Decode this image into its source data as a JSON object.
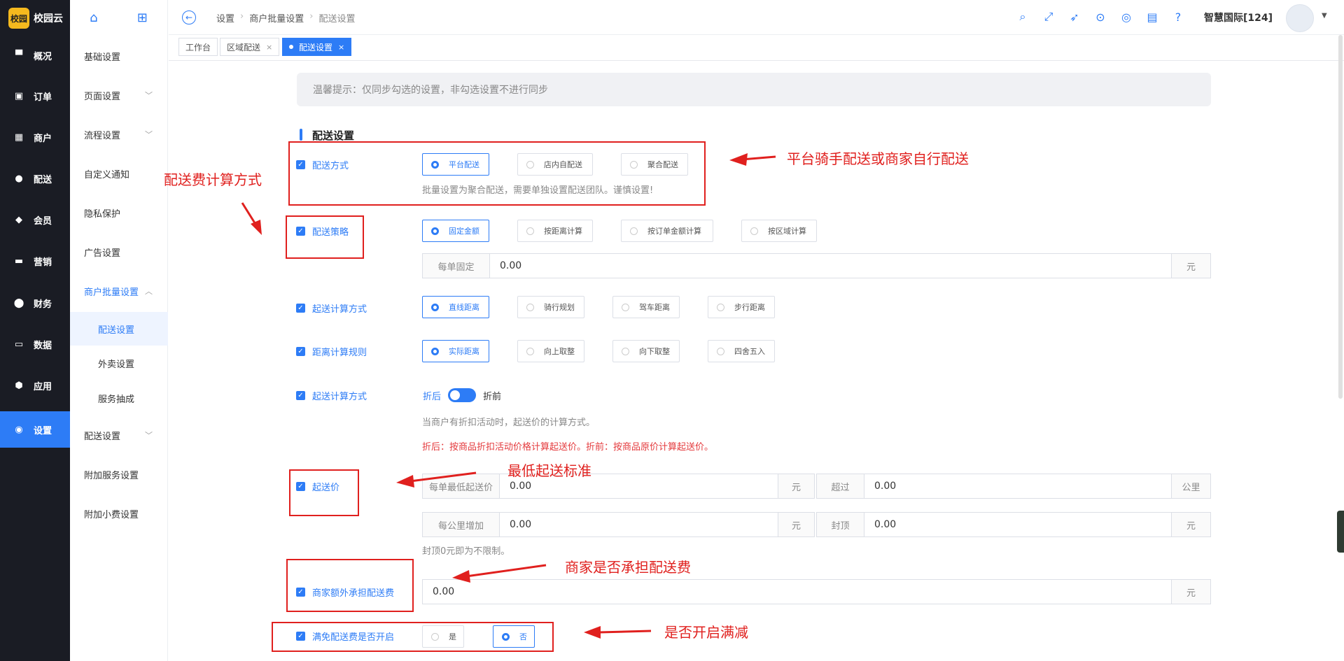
{
  "brand": {
    "mark": "校园",
    "name": "校园云"
  },
  "nav": [
    {
      "label": "概况",
      "icon": "monitor-icon"
    },
    {
      "label": "订单",
      "icon": "order-icon"
    },
    {
      "label": "商户",
      "icon": "shop-icon"
    },
    {
      "label": "配送",
      "icon": "delivery-icon"
    },
    {
      "label": "会员",
      "icon": "member-icon"
    },
    {
      "label": "营销",
      "icon": "marketing-icon"
    },
    {
      "label": "财务",
      "icon": "finance-icon"
    },
    {
      "label": "数据",
      "icon": "data-icon"
    },
    {
      "label": "应用",
      "icon": "app-icon"
    },
    {
      "label": "设置",
      "icon": "settings-icon",
      "active": true
    }
  ],
  "subnav": [
    {
      "label": "基础设置"
    },
    {
      "label": "页面设置",
      "chevron": "﹀"
    },
    {
      "label": "流程设置",
      "chevron": "﹀"
    },
    {
      "label": "自定义通知"
    },
    {
      "label": "隐私保护"
    },
    {
      "label": "广告设置"
    },
    {
      "label": "商户批量设置",
      "chevron": "︿",
      "open": true
    },
    {
      "label": "配送设置",
      "sub": true,
      "selected": true
    },
    {
      "label": "外卖设置",
      "sub": true
    },
    {
      "label": "服务抽成",
      "sub": true
    },
    {
      "label": "配送设置",
      "chevron": "﹀"
    },
    {
      "label": "附加服务设置"
    },
    {
      "label": "附加小费设置"
    }
  ],
  "breadcrumb": [
    "设置",
    "商户批量设置",
    "配送设置"
  ],
  "user": {
    "name": "智慧国际[124]"
  },
  "tabs": [
    {
      "label": "工作台"
    },
    {
      "label": "区域配送"
    },
    {
      "label": "配送设置",
      "active": true
    }
  ],
  "notice": "温馨提示：仅同步勾选的设置，非勾选设置不进行同步",
  "section_title": "配送设置",
  "form": {
    "delivery_mode": {
      "label": "配送方式",
      "options": [
        "平台配送",
        "店内自配送",
        "聚合配送"
      ],
      "selected": 0,
      "hint": "批量设置为聚合配送，需要单独设置配送团队。谨慎设置!"
    },
    "strategy": {
      "label": "配送策略",
      "options": [
        "固定金额",
        "按距离计算",
        "按订单金额计算",
        "按区域计算"
      ],
      "selected": 0,
      "fixed": {
        "prefix": "每单固定",
        "value": "0.00",
        "suffix": "元"
      }
    },
    "start_calc": {
      "label": "起送计算方式",
      "options": [
        "直线距离",
        "骑行规划",
        "驾车距离",
        "步行距离"
      ],
      "selected": 0
    },
    "distance_rule": {
      "label": "距离计算规则",
      "options": [
        "实际距离",
        "向上取整",
        "向下取整",
        "四舍五入"
      ],
      "selected": 0
    },
    "start_price_calc": {
      "label": "起送计算方式",
      "left": "折后",
      "right": "折前",
      "hint1": "当商户有折扣活动时，起送价的计算方式。",
      "hint2": "折后：按商品折扣活动价格计算起送价。折前：按商品原价计算起送价。"
    },
    "start_price": {
      "label": "起送价",
      "min": {
        "prefix": "每单最低起送价",
        "value": "0.00",
        "suffix": "元"
      },
      "over": {
        "prefix": "超过",
        "value": "0.00",
        "suffix": "公里"
      },
      "per_km": {
        "prefix": "每公里增加",
        "value": "0.00",
        "suffix": "元"
      },
      "cap": {
        "prefix": "封顶",
        "value": "0.00",
        "suffix": "元"
      },
      "hint": "封顶0元即为不限制。"
    },
    "merchant_extra": {
      "label": "商家额外承担配送费",
      "value": "0.00",
      "suffix": "元"
    },
    "free_delivery": {
      "label": "满免配送费是否开启",
      "options": [
        "是",
        "否"
      ],
      "selected": 1
    }
  },
  "annotations": {
    "a1": "平台骑手配送或商家自行配送",
    "a2": "配送费计算方式",
    "a3": "最低起送标准",
    "a4": "商家是否承担配送费",
    "a5": "是否开启满减"
  },
  "colors": {
    "accent": "#2d7cf6",
    "sidebar": "#1a1c24",
    "annotation": "#e0201e"
  }
}
